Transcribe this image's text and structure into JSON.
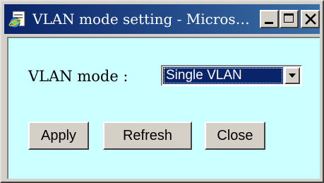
{
  "window": {
    "title": "VLAN mode setting - Microso...",
    "icons": {
      "app": "ie-page-icon",
      "minimize": "minimize-icon",
      "maximize": "maximize-icon",
      "close": "close-icon"
    }
  },
  "form": {
    "label": "VLAN mode :",
    "select_value": "Single VLAN"
  },
  "buttons": {
    "apply": "Apply",
    "refresh": "Refresh",
    "close": "Close"
  },
  "colors": {
    "client_background": "#ccffff",
    "titlebar_start": "#0a246a",
    "titlebar_end": "#3a6ea5",
    "selection": "#0a246a"
  }
}
